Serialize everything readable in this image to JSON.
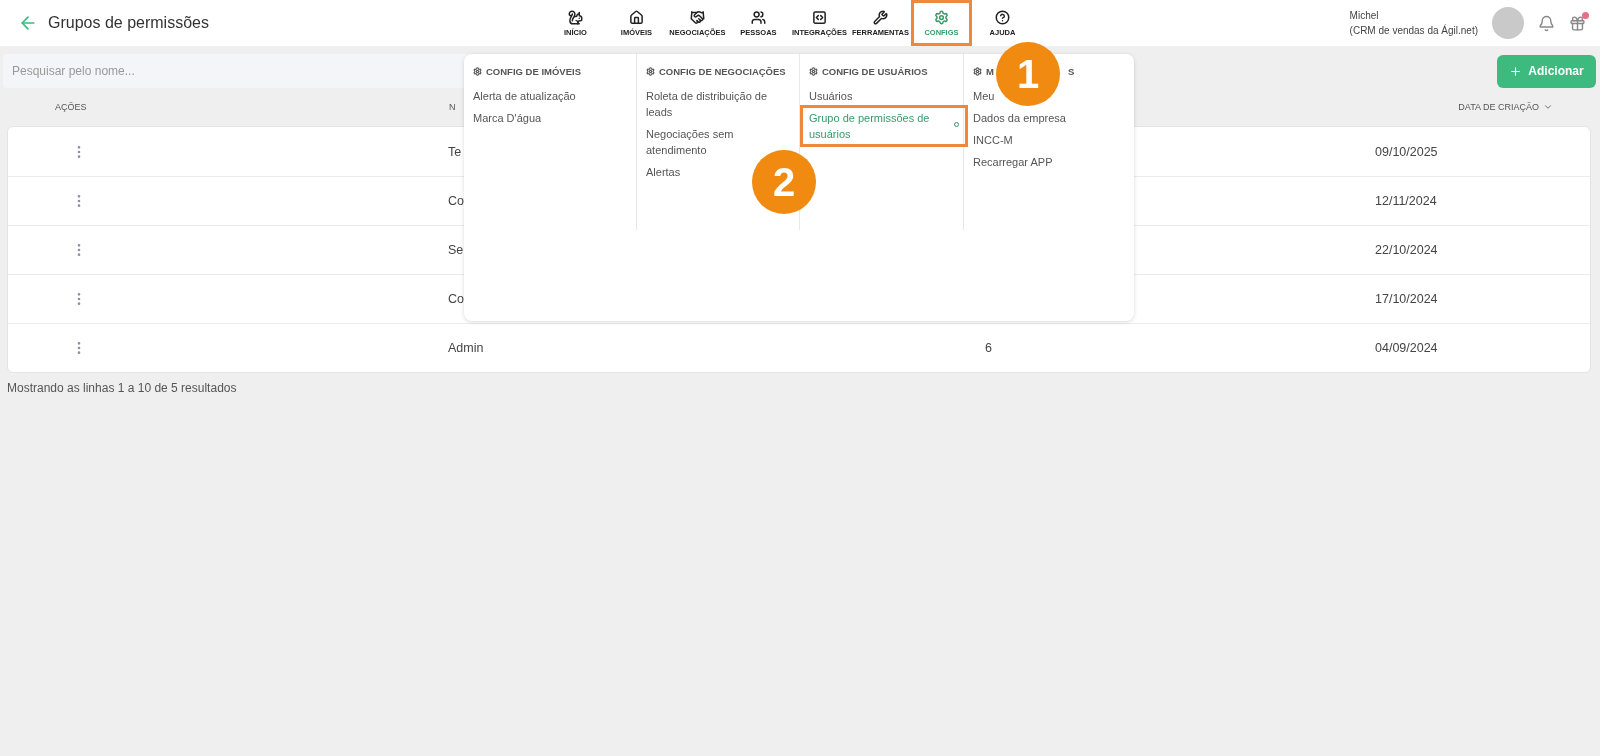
{
  "header": {
    "title": "Grupos de permissões",
    "nav": [
      {
        "label": "INÍCIO",
        "selected": false,
        "highlighted": false
      },
      {
        "label": "IMÓVEIS",
        "selected": false,
        "highlighted": false
      },
      {
        "label": "NEGOCIAÇÕES",
        "selected": false,
        "highlighted": false
      },
      {
        "label": "PESSOAS",
        "selected": false,
        "highlighted": false
      },
      {
        "label": "INTEGRAÇÕES",
        "selected": false,
        "highlighted": false
      },
      {
        "label": "FERRAMENTAS",
        "selected": false,
        "highlighted": false
      },
      {
        "label": "CONFIGS",
        "selected": true,
        "highlighted": true
      },
      {
        "label": "AJUDA",
        "selected": false,
        "highlighted": false
      }
    ],
    "user": {
      "name": "Michel",
      "company": "(CRM de vendas da Ágil.net)"
    },
    "gift_badge": true
  },
  "search": {
    "placeholder": "Pesquisar pelo nome..."
  },
  "add_button": {
    "label": "Adicionar"
  },
  "table": {
    "columns": [
      "AÇÕES",
      "N",
      "DATA DE CRIAÇÃO"
    ],
    "rows": [
      {
        "name": "Te",
        "count": "",
        "date": "09/10/2025"
      },
      {
        "name": "Co",
        "count": "",
        "date": "12/11/2024"
      },
      {
        "name": "Se",
        "count": "",
        "date": "22/10/2024"
      },
      {
        "name": "Co",
        "count": "",
        "date": "17/10/2024"
      },
      {
        "name": "Admin",
        "count": "6",
        "date": "04/09/2024"
      }
    ]
  },
  "footer": "Mostrando as linhas 1 a 10 de 5 resultados",
  "menu": {
    "columns": [
      {
        "heading": [
          "CONFIG DE IMÓVEIS"
        ],
        "items": [
          {
            "label": "Alerta de atualização",
            "selected": false,
            "highlighted": false
          },
          {
            "label": "Marca D'água",
            "selected": false,
            "highlighted": false
          }
        ]
      },
      {
        "heading": [
          "CONFIG DE NEGOCIAÇÕES"
        ],
        "items": [
          {
            "label": "Roleta de distribuição de leads",
            "selected": false,
            "highlighted": false
          },
          {
            "label": "Negociações sem atendimento",
            "selected": false,
            "highlighted": false
          },
          {
            "label": "Alertas",
            "selected": false,
            "highlighted": false
          }
        ]
      },
      {
        "heading": [
          "CONFIG DE USUÁRIOS"
        ],
        "items": [
          {
            "label": "Usuários",
            "selected": false,
            "highlighted": false
          },
          {
            "label": "Grupo de permissões de usuários",
            "selected": true,
            "highlighted": true
          }
        ]
      },
      {
        "heading": [
          "M",
          "S"
        ],
        "items": [
          {
            "label": "Meu",
            "selected": false,
            "highlighted": false
          },
          {
            "label": "Dados da empresa",
            "selected": false,
            "highlighted": false
          },
          {
            "label": "INCC-M",
            "selected": false,
            "highlighted": false
          },
          {
            "label": "Recarregar APP",
            "selected": false,
            "highlighted": false
          }
        ]
      }
    ]
  },
  "annotations": [
    {
      "label": "1"
    },
    {
      "label": "2"
    }
  ]
}
